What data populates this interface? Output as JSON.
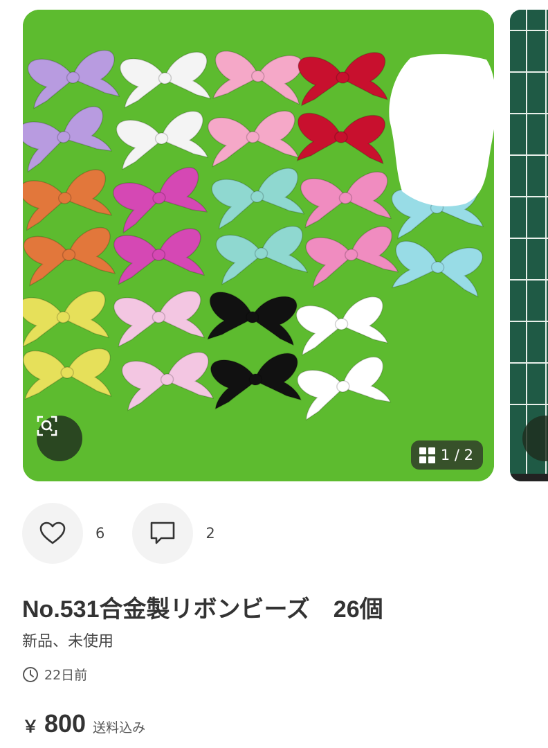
{
  "gallery": {
    "counter": "1 / 2",
    "zoom_icon": "zoom-scan-icon",
    "grid_icon": "grid-icon",
    "main_photo": "ribbon-beads-photo",
    "bead_colors": [
      "#b89be0",
      "#f4f4f4",
      "#f5a8c8",
      "#c8102e",
      "#e2773b",
      "#d548b4",
      "#8fd8d0",
      "#f08cc0",
      "#98dce6",
      "#e6e05a",
      "#f3c6e2",
      "#111111",
      "#ffffff"
    ]
  },
  "actions": {
    "like_icon": "heart-icon",
    "like_count": "6",
    "comment_icon": "comment-icon",
    "comment_count": "2"
  },
  "product": {
    "title": "No.531合金製リボンビーズ　26個",
    "condition": "新品、未使用",
    "posted_icon": "clock-icon",
    "posted": "22日前",
    "currency": "￥",
    "price": "800",
    "shipping": "送料込み"
  }
}
